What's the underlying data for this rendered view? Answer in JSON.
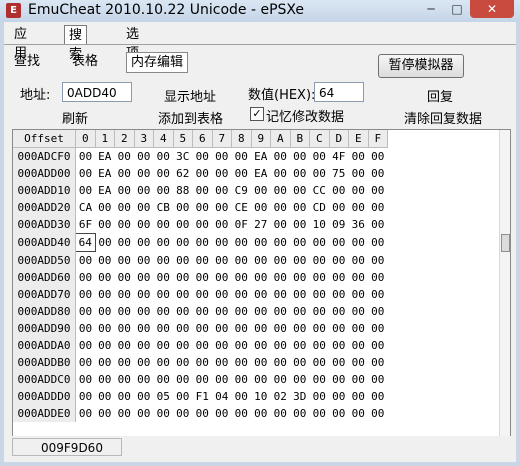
{
  "window": {
    "title": "EmuCheat 2010.10.22 Unicode - ePSXe"
  },
  "tabs": [
    {
      "label": "应用"
    },
    {
      "label": "搜索"
    },
    {
      "label": "选项"
    }
  ],
  "subtabs": [
    {
      "label": "查找"
    },
    {
      "label": "表格"
    },
    {
      "label": "内存编辑"
    }
  ],
  "controls": {
    "pause_button": "暂停模拟器",
    "address_label": "地址:",
    "address_value": "0ADD40",
    "show_address": "显示地址",
    "value_label": "数值(HEX):",
    "value_value": "64",
    "restore": "回复",
    "refresh": "刷新",
    "add_to_table": "添加到表格",
    "remember_label": "记忆修改数据",
    "remember_checked": "✓",
    "clear_restore": "清除回复数据"
  },
  "hexgrid": {
    "header": [
      "Offset",
      "0",
      "1",
      "2",
      "3",
      "4",
      "5",
      "6",
      "7",
      "8",
      "9",
      "A",
      "B",
      "C",
      "D",
      "E",
      "F"
    ],
    "rows": [
      {
        "addr": "000ADCF0",
        "bytes": [
          "00",
          "EA",
          "00",
          "00",
          "00",
          "3C",
          "00",
          "00",
          "00",
          "EA",
          "00",
          "00",
          "00",
          "4F",
          "00",
          "00"
        ]
      },
      {
        "addr": "000ADD00",
        "bytes": [
          "00",
          "EA",
          "00",
          "00",
          "00",
          "62",
          "00",
          "00",
          "00",
          "EA",
          "00",
          "00",
          "00",
          "75",
          "00",
          "00"
        ]
      },
      {
        "addr": "000ADD10",
        "bytes": [
          "00",
          "EA",
          "00",
          "00",
          "00",
          "88",
          "00",
          "00",
          "C9",
          "00",
          "00",
          "00",
          "CC",
          "00",
          "00",
          "00"
        ]
      },
      {
        "addr": "000ADD20",
        "bytes": [
          "CA",
          "00",
          "00",
          "00",
          "CB",
          "00",
          "00",
          "00",
          "CE",
          "00",
          "00",
          "00",
          "CD",
          "00",
          "00",
          "00"
        ]
      },
      {
        "addr": "000ADD30",
        "bytes": [
          "6F",
          "00",
          "00",
          "00",
          "00",
          "00",
          "00",
          "00",
          "0F",
          "27",
          "00",
          "00",
          "10",
          "09",
          "36",
          "00"
        ]
      },
      {
        "addr": "000ADD40",
        "bytes": [
          "64",
          "00",
          "00",
          "00",
          "00",
          "00",
          "00",
          "00",
          "00",
          "00",
          "00",
          "00",
          "00",
          "00",
          "00",
          "00"
        ]
      },
      {
        "addr": "000ADD50",
        "bytes": [
          "00",
          "00",
          "00",
          "00",
          "00",
          "00",
          "00",
          "00",
          "00",
          "00",
          "00",
          "00",
          "00",
          "00",
          "00",
          "00"
        ]
      },
      {
        "addr": "000ADD60",
        "bytes": [
          "00",
          "00",
          "00",
          "00",
          "00",
          "00",
          "00",
          "00",
          "00",
          "00",
          "00",
          "00",
          "00",
          "00",
          "00",
          "00"
        ]
      },
      {
        "addr": "000ADD70",
        "bytes": [
          "00",
          "00",
          "00",
          "00",
          "00",
          "00",
          "00",
          "00",
          "00",
          "00",
          "00",
          "00",
          "00",
          "00",
          "00",
          "00"
        ]
      },
      {
        "addr": "000ADD80",
        "bytes": [
          "00",
          "00",
          "00",
          "00",
          "00",
          "00",
          "00",
          "00",
          "00",
          "00",
          "00",
          "00",
          "00",
          "00",
          "00",
          "00"
        ]
      },
      {
        "addr": "000ADD90",
        "bytes": [
          "00",
          "00",
          "00",
          "00",
          "00",
          "00",
          "00",
          "00",
          "00",
          "00",
          "00",
          "00",
          "00",
          "00",
          "00",
          "00"
        ]
      },
      {
        "addr": "000ADDA0",
        "bytes": [
          "00",
          "00",
          "00",
          "00",
          "00",
          "00",
          "00",
          "00",
          "00",
          "00",
          "00",
          "00",
          "00",
          "00",
          "00",
          "00"
        ]
      },
      {
        "addr": "000ADDB0",
        "bytes": [
          "00",
          "00",
          "00",
          "00",
          "00",
          "00",
          "00",
          "00",
          "00",
          "00",
          "00",
          "00",
          "00",
          "00",
          "00",
          "00"
        ]
      },
      {
        "addr": "000ADDC0",
        "bytes": [
          "00",
          "00",
          "00",
          "00",
          "00",
          "00",
          "00",
          "00",
          "00",
          "00",
          "00",
          "00",
          "00",
          "00",
          "00",
          "00"
        ]
      },
      {
        "addr": "000ADDD0",
        "bytes": [
          "00",
          "00",
          "00",
          "00",
          "05",
          "00",
          "F1",
          "04",
          "00",
          "10",
          "02",
          "3D",
          "00",
          "00",
          "00",
          "00"
        ]
      },
      {
        "addr": "000ADDE0",
        "bytes": [
          "00",
          "00",
          "00",
          "00",
          "00",
          "00",
          "00",
          "00",
          "00",
          "00",
          "00",
          "00",
          "00",
          "00",
          "00",
          "00"
        ]
      }
    ],
    "selected": {
      "row": 5,
      "col": 0
    }
  },
  "status": {
    "text": "009F9D60"
  }
}
